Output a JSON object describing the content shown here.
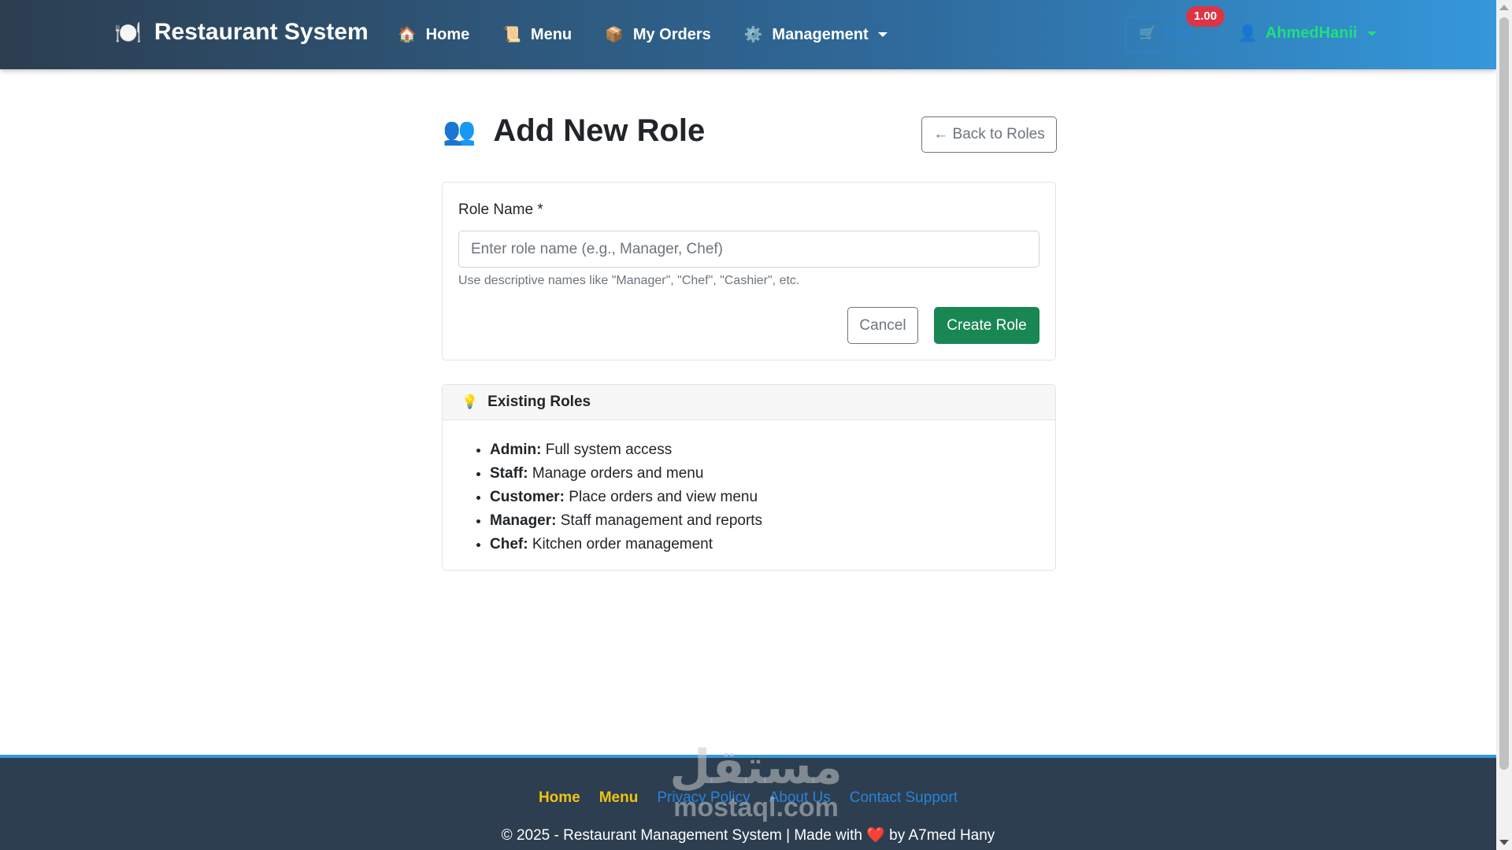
{
  "navbar": {
    "brand_icon": "plate-icon",
    "brand": "Restaurant System",
    "links": [
      {
        "label": "Home",
        "icon": "house-icon"
      },
      {
        "label": "Menu",
        "icon": "scroll-icon"
      },
      {
        "label": "My Orders",
        "icon": "package-icon"
      },
      {
        "label": "Management",
        "icon": "gear-icon",
        "dropdown": true
      }
    ],
    "cart_label": "Cart",
    "cart_badge": "1.00",
    "user_name": "AhmedHanii"
  },
  "main": {
    "title": "Add New Role",
    "back_button": "← Back to Roles",
    "form": {
      "label": "Role Name *",
      "placeholder": "Enter role name (e.g., Manager, Chef)",
      "value": "",
      "help": "Use descriptive names like \"Manager\", \"Chef\", \"Cashier\", etc.",
      "cancel": "Cancel",
      "create": "Create Role"
    },
    "existing_roles": {
      "title": "Existing Roles",
      "items": [
        {
          "name": "Admin:",
          "desc": "Full system access"
        },
        {
          "name": "Staff:",
          "desc": "Manage orders and menu"
        },
        {
          "name": "Customer:",
          "desc": "Place orders and view menu"
        },
        {
          "name": "Manager:",
          "desc": "Staff management and reports"
        },
        {
          "name": "Chef:",
          "desc": "Kitchen order management"
        }
      ]
    }
  },
  "footer": {
    "links": [
      "Home",
      "Menu",
      "Privacy Policy",
      "About Us",
      "Contact Support"
    ],
    "copyright_prefix": "© 2025 - Restaurant Management System | Made with",
    "copyright_suffix": "by A7med Hany"
  },
  "watermark": {
    "arabic": "مستقل",
    "latin": "mostaql.com"
  },
  "colors": {
    "navbar_start": "#2c3e50",
    "navbar_end": "#3498db",
    "create_button": "#198754",
    "badge": "#dc3545",
    "user_name": "#1ee07a",
    "footer_link_accent": "#f1c40f",
    "footer_bg": "#2c3e50"
  }
}
